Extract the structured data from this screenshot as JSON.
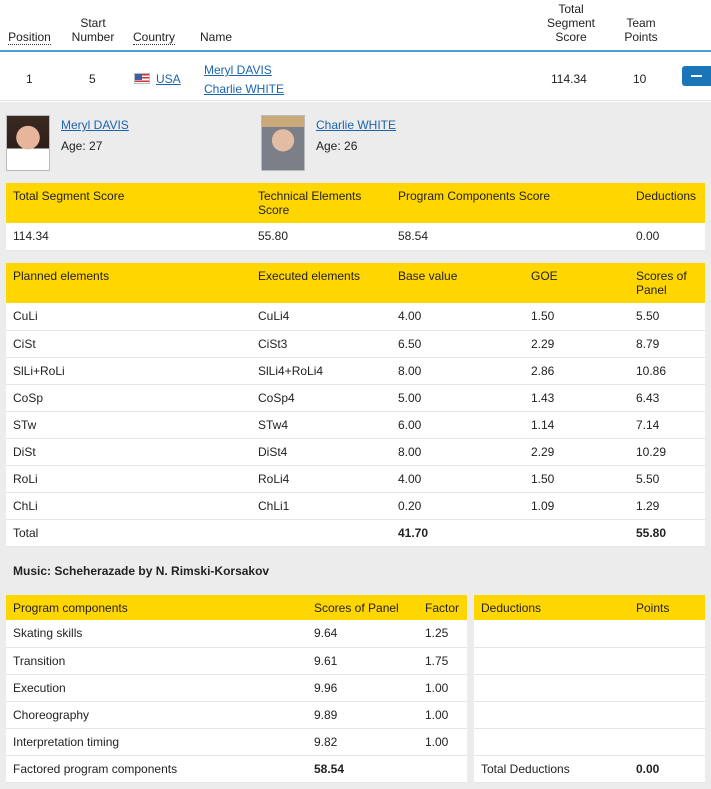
{
  "header": {
    "position": "Position",
    "start_number": [
      "Start",
      "Number"
    ],
    "country": "Country",
    "name": "Name",
    "total_segment_score": [
      "Total",
      "Segment",
      "Score"
    ],
    "team_points": [
      "Team",
      "Points"
    ]
  },
  "entry": {
    "position": "1",
    "start_number": "5",
    "country": "USA",
    "skater1": "Meryl DAVIS",
    "skater2": "Charlie WHITE",
    "total_segment_score": "114.34",
    "team_points": "10"
  },
  "skaters": [
    {
      "name": "Meryl DAVIS",
      "age": "Age: 27"
    },
    {
      "name": "Charlie WHITE",
      "age": "Age: 26"
    }
  ],
  "summary": {
    "headers": [
      "Total Segment Score",
      "Technical Elements Score",
      "Program Components Score",
      "Deductions"
    ],
    "values": [
      "114.34",
      "55.80",
      "58.54",
      "0.00"
    ]
  },
  "elements": {
    "headers": [
      "Planned elements",
      "Executed elements",
      "Base value",
      "GOE",
      "Scores of Panel"
    ],
    "rows": [
      [
        "CuLi",
        "CuLi4",
        "4.00",
        "1.50",
        "5.50"
      ],
      [
        "CiSt",
        "CiSt3",
        "6.50",
        "2.29",
        "8.79"
      ],
      [
        "SlLi+RoLi",
        "SlLi4+RoLi4",
        "8.00",
        "2.86",
        "10.86"
      ],
      [
        "CoSp",
        "CoSp4",
        "5.00",
        "1.43",
        "6.43"
      ],
      [
        "STw",
        "STw4",
        "6.00",
        "1.14",
        "7.14"
      ],
      [
        "DiSt",
        "DiSt4",
        "8.00",
        "2.29",
        "10.29"
      ],
      [
        "RoLi",
        "RoLi4",
        "4.00",
        "1.50",
        "5.50"
      ],
      [
        "ChLi",
        "ChLi1",
        "0.20",
        "1.09",
        "1.29"
      ]
    ],
    "total": {
      "label": "Total",
      "base": "41.70",
      "score": "55.80"
    }
  },
  "music": "Music: Scheherazade by N. Rimski-Korsakov",
  "components": {
    "headers": [
      "Program components",
      "Scores of Panel",
      "Factor"
    ],
    "rows": [
      [
        "Skating skills",
        "9.64",
        "1.25"
      ],
      [
        "Transition",
        "9.61",
        "1.75"
      ],
      [
        "Execution",
        "9.96",
        "1.00"
      ],
      [
        "Choreography",
        "9.89",
        "1.00"
      ],
      [
        "Interpretation timing",
        "9.82",
        "1.00"
      ]
    ],
    "factored": {
      "label": "Factored program components",
      "value": "58.54"
    }
  },
  "deductions": {
    "headers": [
      "Deductions",
      "Points"
    ],
    "total": {
      "label": "Total Deductions",
      "value": "0.00"
    }
  },
  "colors": {
    "accent_yellow": "#ffd600",
    "link_blue": "#1a64b0",
    "panel_grey": "#ececec",
    "header_rule": "#4aa0d6"
  }
}
